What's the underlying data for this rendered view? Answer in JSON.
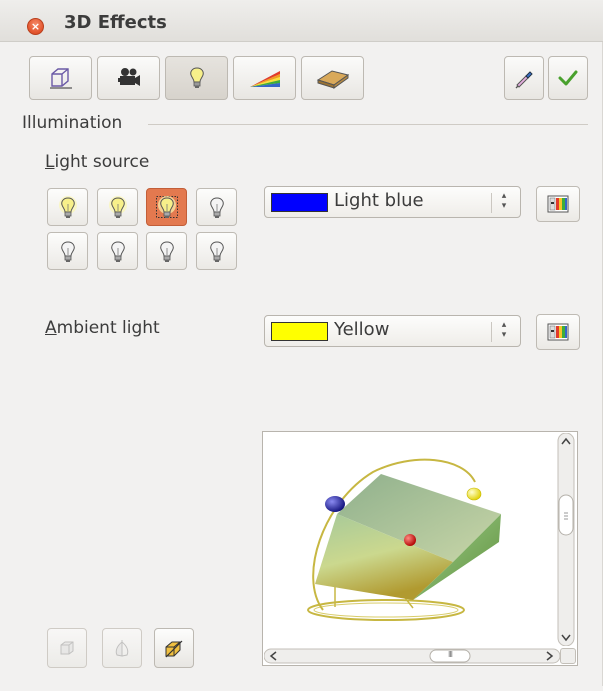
{
  "window": {
    "title": "3D Effects",
    "close_glyph": "×"
  },
  "toolbar": {
    "buttons": [
      {
        "name": "geometry-icon",
        "active": false
      },
      {
        "name": "shading-camera-icon",
        "active": false
      },
      {
        "name": "illumination-bulb-icon",
        "active": true
      },
      {
        "name": "textures-icon",
        "active": false
      },
      {
        "name": "material-icon",
        "active": false
      }
    ],
    "right_buttons": [
      {
        "name": "assign-eyedropper-icon"
      },
      {
        "name": "apply-checkmark-icon"
      }
    ]
  },
  "illumination": {
    "section_label": "Illumination",
    "light_source": {
      "label_mnemonic": "L",
      "label_rest": "ight source",
      "color_name": "Light blue",
      "color_hex": "#0000ff",
      "selected_index": 2,
      "lights_on": [
        true,
        true,
        true,
        false,
        false,
        false,
        false,
        false
      ]
    },
    "ambient_light": {
      "label_mnemonic": "A",
      "label_rest": "mbient light",
      "color_name": "Yellow",
      "color_hex": "#ffff00"
    }
  },
  "colors": {
    "accent_selected": "#e3794f",
    "dialog_bg": "#f2f1f0"
  },
  "preview": {
    "hscroll_grip": "III"
  }
}
